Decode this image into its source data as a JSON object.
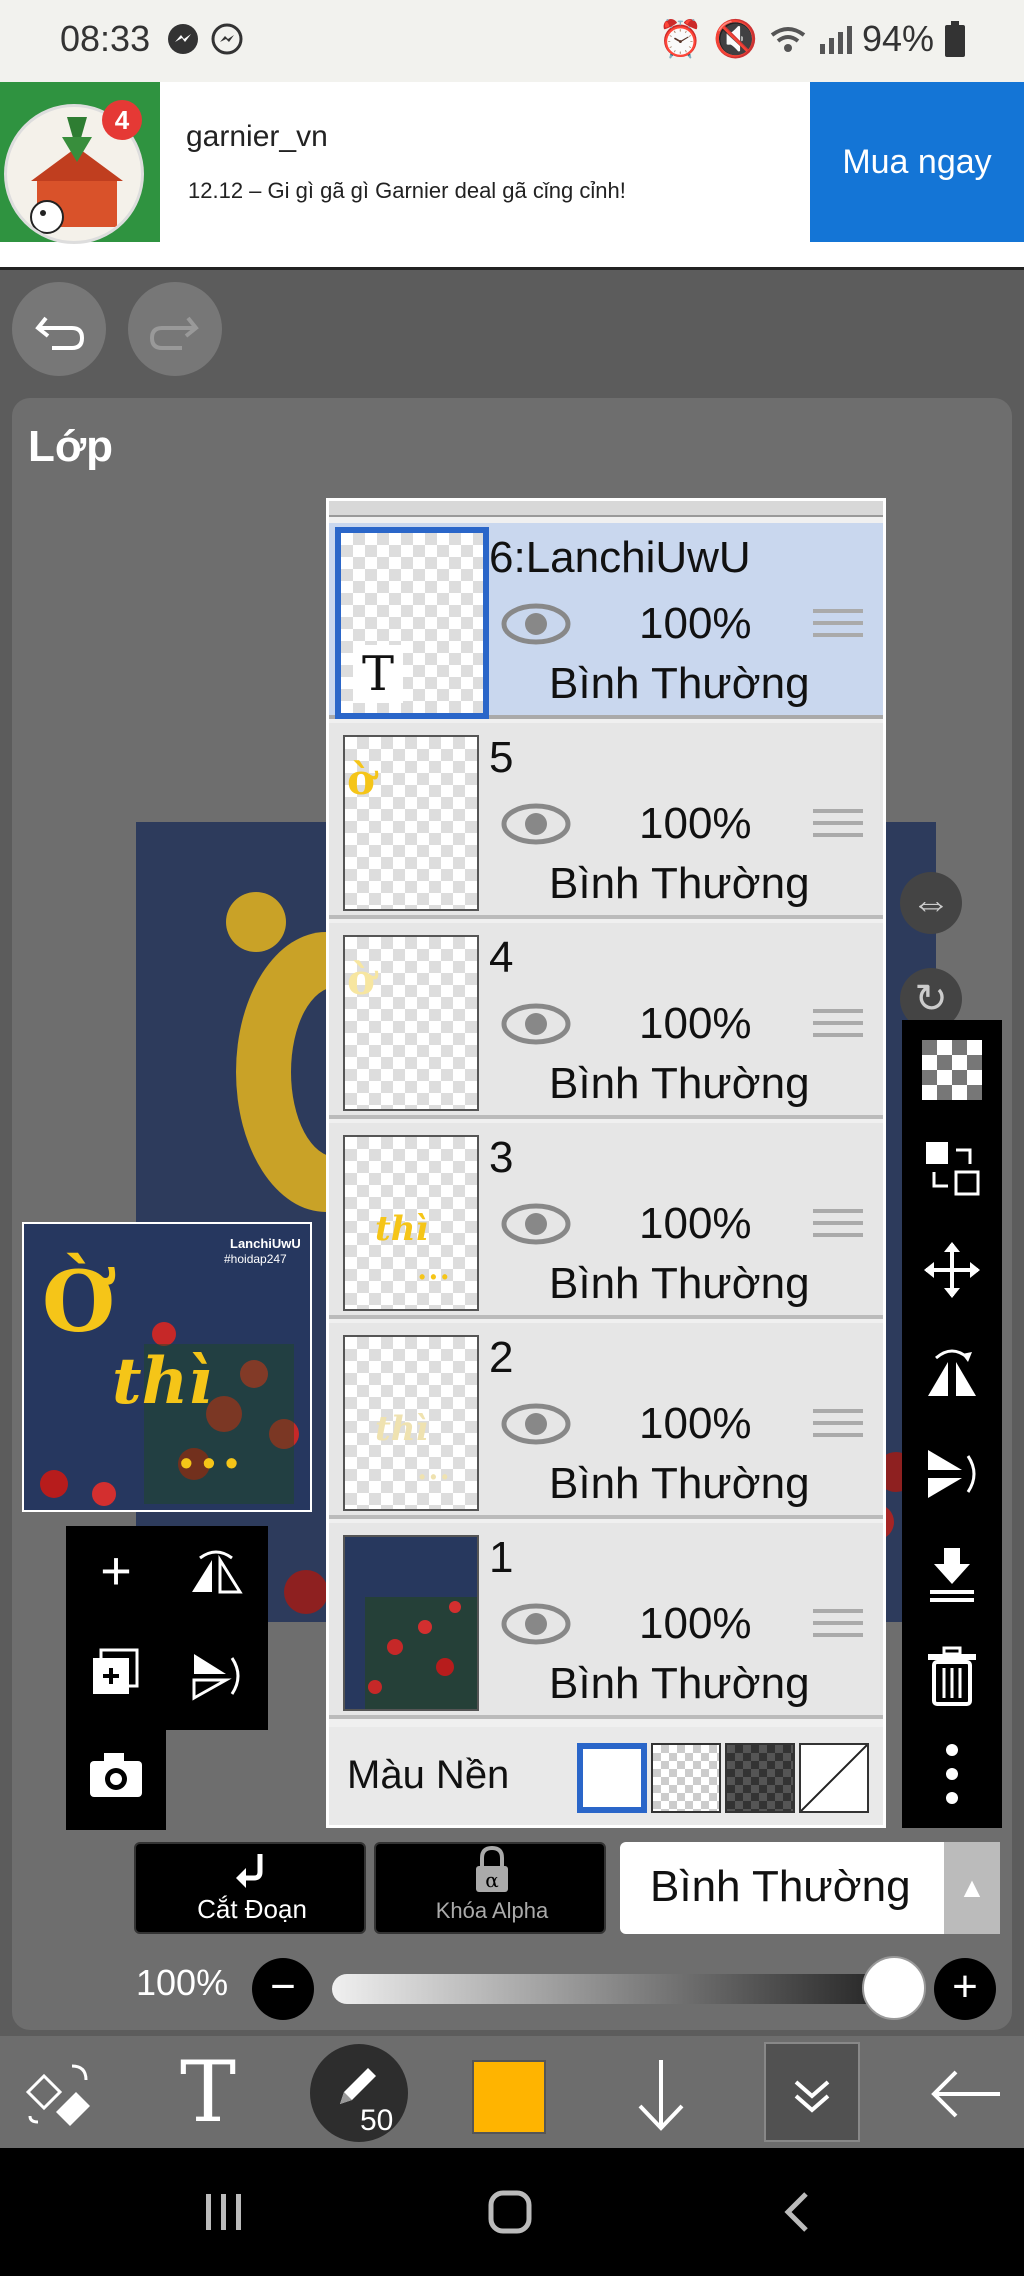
{
  "status_bar": {
    "time": "08:33",
    "battery": "94%",
    "icons": [
      "messenger-icon",
      "messenger-icon",
      "alarm-icon",
      "mute-icon",
      "wifi-icon",
      "signal-icon",
      "battery-icon"
    ]
  },
  "ad": {
    "badge": "4",
    "brand": "garnier_vn",
    "description": "12.12 – Gi gì gã gì Garnier deal gã cǐng cỉnh!",
    "cta": "Mua ngay"
  },
  "panel": {
    "title": "Lớp"
  },
  "preview": {
    "text_top": "LanchiUwU",
    "text_sub": "#hoidap247",
    "big1": "Ờ",
    "big2": "thì",
    "dots": "• • •"
  },
  "layers": [
    {
      "name": "6:LanchiUwU",
      "opacity": "100%",
      "mode": "Bình Thường",
      "thumb_letter": "T",
      "selected": true
    },
    {
      "name": "5",
      "opacity": "100%",
      "mode": "Bình Thường"
    },
    {
      "name": "4",
      "opacity": "100%",
      "mode": "Bình Thường"
    },
    {
      "name": "3",
      "opacity": "100%",
      "mode": "Bình Thường"
    },
    {
      "name": "2",
      "opacity": "100%",
      "mode": "Bình Thường"
    },
    {
      "name": "1",
      "opacity": "100%",
      "mode": "Bình Thường"
    }
  ],
  "background_row": {
    "label": "Màu Nền"
  },
  "bottom": {
    "clip_label": "Cắt Đoạn",
    "alpha_label": "Khóa Alpha",
    "blend_mode": "Bình Thường",
    "opacity_label": "100%",
    "minus": "−",
    "plus": "+"
  },
  "toolbar": {
    "brush_size": "50",
    "color": "#ffb400"
  }
}
